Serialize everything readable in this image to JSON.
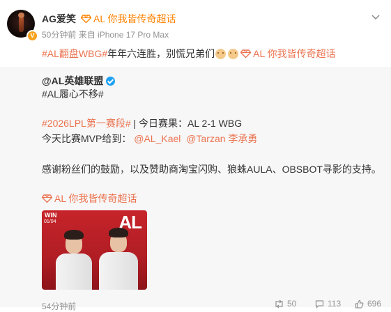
{
  "user": {
    "name": "AG爱笑",
    "tag": "AL 你我皆传奇超话",
    "time": "50分钟前",
    "device": "来自 iPhone 17 Pro Max"
  },
  "post": {
    "hashtag": "#AL翻盘WBG#",
    "text": " 年年六连胜，别慌兄弟们",
    "supertopic": "AL 你我皆传奇超话"
  },
  "repost": {
    "author": "@AL英雄联盟",
    "hashtag1": "#AL履心不移#",
    "hashtag2": "#2026LPL第一赛段#",
    "result_text": " | 今日赛果：AL 2-1 WBG",
    "mvp_prefix": "今天比赛MVP给到：",
    "mvp1": "@AL_Kael",
    "mvp2": "@Tarzan 李承勇",
    "thanks": "感谢粉丝们的鼓励，以及赞助商淘宝闪购、狼蛛AULA、OBSBOT寻影的支持。",
    "supertopic": "AL 你我皆传奇超话",
    "photo_year": "WIN",
    "photo_date": "01/04",
    "photo_logo": "AL",
    "time": "54分钟前",
    "reposts": "50",
    "comments": "113",
    "likes": "696"
  },
  "colors": {
    "link_orange": "#eb7350",
    "tag_orange": "#ff8200",
    "meta_gray": "#939393"
  },
  "icons": [
    "more-icon",
    "supertopic-gem-icon",
    "verified-icon",
    "repost-icon",
    "comment-icon",
    "like-icon"
  ]
}
